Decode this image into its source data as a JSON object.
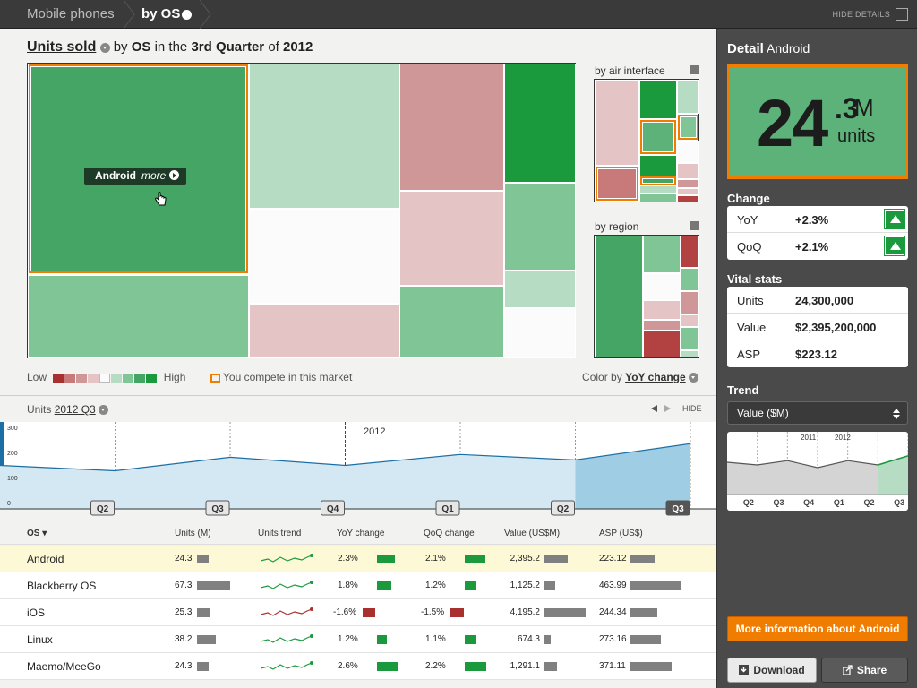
{
  "breadcrumb": {
    "item1": "Mobile phones",
    "item2": "by OS"
  },
  "topbar": {
    "hide_details": "HIDE DETAILS"
  },
  "title": {
    "metric": "Units sold",
    "by": "by",
    "dimension": "OS",
    "in_the": "in the",
    "quarter": "3rd Quarter",
    "of": "of",
    "year": "2012"
  },
  "tooltip": {
    "label": "Android",
    "more": "more"
  },
  "minimaps": {
    "air": "by air interface",
    "region": "by region"
  },
  "legend": {
    "low": "Low",
    "high": "High",
    "compete": "You compete in this market",
    "color_by": "Color by",
    "color_metric": "YoY change"
  },
  "timeline": {
    "label_prefix": "Units",
    "period": "2012 Q3",
    "hide": "HIDE",
    "year_label": "2012",
    "y_ticks": [
      "300",
      "200",
      "100",
      "0"
    ],
    "quarters": [
      "Q2",
      "Q3",
      "Q4",
      "Q1",
      "Q2",
      "Q3"
    ],
    "values": [
      160,
      140,
      190,
      160,
      200,
      180,
      240
    ]
  },
  "table": {
    "headers": {
      "os": "OS ▾",
      "units": "Units (M)",
      "trend": "Units trend",
      "yoy": "YoY change",
      "qoq": "QoQ change",
      "value": "Value (US$M)",
      "asp": "ASP (US$)"
    },
    "rows": [
      {
        "os": "Android",
        "units": "24.3",
        "yoy": "2.3%",
        "qoq": "2.1%",
        "value": "2,395.2",
        "asp": "223.12",
        "u": 24.3,
        "y": 2.3,
        "q": 2.1,
        "v": 2395.2,
        "a": 223.12,
        "spark": "up"
      },
      {
        "os": "Blackberry OS",
        "units": "67.3",
        "yoy": "1.8%",
        "qoq": "1.2%",
        "value": "1,125.2",
        "asp": "463.99",
        "u": 67.3,
        "y": 1.8,
        "q": 1.2,
        "v": 1125.2,
        "a": 463.99,
        "spark": "up"
      },
      {
        "os": "iOS",
        "units": "25.3",
        "yoy": "-1.6%",
        "qoq": "-1.5%",
        "value": "4,195.2",
        "asp": "244.34",
        "u": 25.3,
        "y": -1.6,
        "q": -1.5,
        "v": 4195.2,
        "a": 244.34,
        "spark": "down"
      },
      {
        "os": "Linux",
        "units": "38.2",
        "yoy": "1.2%",
        "qoq": "1.1%",
        "value": "674.3",
        "asp": "273.16",
        "u": 38.2,
        "y": 1.2,
        "q": 1.1,
        "v": 674.3,
        "a": 273.16,
        "spark": "up"
      },
      {
        "os": "Maemo/MeeGo",
        "units": "24.3",
        "yoy": "2.6%",
        "qoq": "2.2%",
        "value": "1,291.1",
        "asp": "371.11",
        "u": 24.3,
        "y": 2.6,
        "q": 2.2,
        "v": 1291.1,
        "a": 371.11,
        "spark": "up"
      }
    ]
  },
  "detail": {
    "title_prefix": "Detail",
    "name": "Android",
    "big_int": "24",
    "big_dec": ".3",
    "big_suffix": "M",
    "big_unit": "units",
    "change_label": "Change",
    "yoy_label": "YoY",
    "yoy_value": "+2.3%",
    "qoq_label": "QoQ",
    "qoq_value": "+2.1%",
    "vital_label": "Vital stats",
    "units_label": "Units",
    "units_value": "24,300,000",
    "value_label": "Value",
    "value_value": "$2,395,200,000",
    "asp_label": "ASP",
    "asp_value": "$223.12",
    "trend_label": "Trend",
    "trend_select": "Value ($M)",
    "trend_years": [
      "2011",
      "2012"
    ],
    "trend_quarters": [
      "Q2",
      "Q3",
      "Q4",
      "Q1",
      "Q2",
      "Q3"
    ],
    "trend_values": [
      60,
      55,
      63,
      50,
      63,
      55,
      72
    ],
    "more_button": "More information about Android",
    "download": "Download",
    "share": "Share"
  },
  "colors": {
    "accent": "#f07d00",
    "green_dark": "#1a9a3c",
    "red_dark": "#a8312f"
  }
}
